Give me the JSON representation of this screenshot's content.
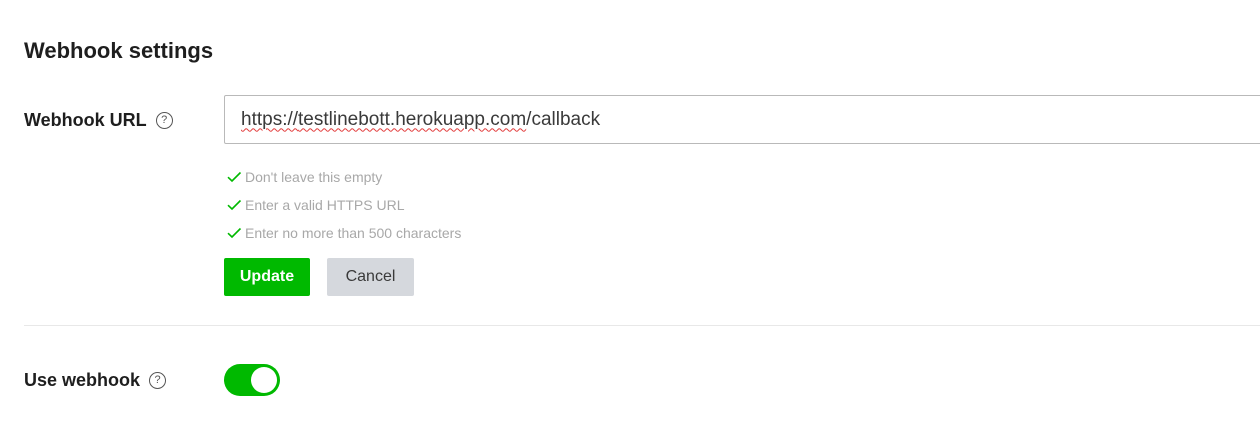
{
  "section": {
    "title": "Webhook settings"
  },
  "webhook_url": {
    "label": "Webhook URL",
    "help_glyph": "?",
    "value_part1": "https://",
    "value_part2": "testlinebott.herokuapp.com",
    "value_part3": "/callback",
    "rules": [
      {
        "text": "Don't leave this empty",
        "status": "valid"
      },
      {
        "text": "Enter a valid HTTPS URL",
        "status": "valid"
      },
      {
        "text": "Enter no more than 500 characters",
        "status": "valid"
      }
    ]
  },
  "buttons": {
    "update_label": "Update",
    "cancel_label": "Cancel"
  },
  "use_webhook": {
    "label": "Use webhook",
    "help_glyph": "?",
    "enabled": true
  },
  "colors": {
    "accent_green": "#00b900",
    "check_green": "#00b900",
    "cancel_gray": "#d5d8dd",
    "rule_text_gray": "#a8a8a8"
  },
  "icons": {
    "help": "question-circle-icon",
    "check": "check-icon"
  }
}
